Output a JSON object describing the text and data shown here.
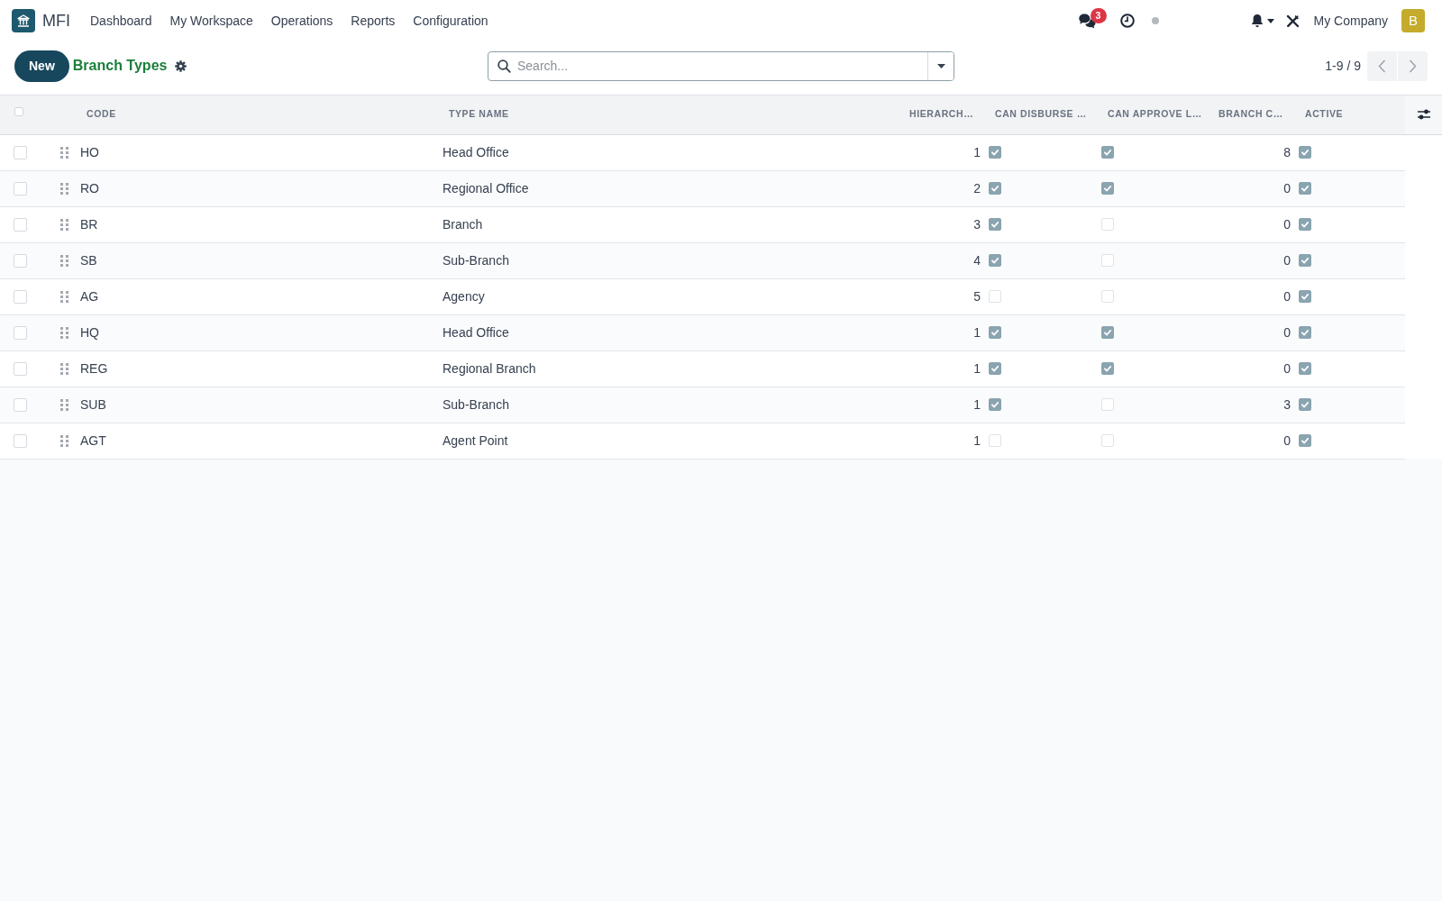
{
  "navbar": {
    "app_name": "MFI",
    "menu": [
      "Dashboard",
      "My Workspace",
      "Operations",
      "Reports",
      "Configuration"
    ],
    "unread_messages": "3",
    "company": "My Company",
    "avatar_initial": "B"
  },
  "control_panel": {
    "new_button": "New",
    "title": "Branch Types",
    "search": {
      "placeholder": "Search..."
    },
    "pager": "1-9 / 9"
  },
  "table": {
    "select_all": {
      "checked": false
    },
    "columns": [
      {
        "label": "CODE",
        "kind": "text"
      },
      {
        "label": "TYPE NAME",
        "kind": "text"
      },
      {
        "label": "HIERARCH…",
        "kind": "number"
      },
      {
        "label": "CAN DISBURSE …",
        "kind": "boolean"
      },
      {
        "label": "CAN APPROVE L…",
        "kind": "boolean"
      },
      {
        "label": "BRANCH C…",
        "kind": "number"
      },
      {
        "label": "ACTIVE",
        "kind": "boolean"
      }
    ],
    "rows": [
      {
        "selected": false,
        "cells": [
          {
            "text": "HO"
          },
          {
            "text": "Head Office"
          },
          {
            "text": "1"
          },
          {
            "checked": true
          },
          {
            "checked": true
          },
          {
            "text": "8"
          },
          {
            "checked": true
          }
        ]
      },
      {
        "selected": false,
        "cells": [
          {
            "text": "RO"
          },
          {
            "text": "Regional Office"
          },
          {
            "text": "2"
          },
          {
            "checked": true
          },
          {
            "checked": true
          },
          {
            "text": "0"
          },
          {
            "checked": true
          }
        ]
      },
      {
        "selected": false,
        "cells": [
          {
            "text": "BR"
          },
          {
            "text": "Branch"
          },
          {
            "text": "3"
          },
          {
            "checked": true
          },
          {
            "checked": false
          },
          {
            "text": "0"
          },
          {
            "checked": true
          }
        ]
      },
      {
        "selected": false,
        "cells": [
          {
            "text": "SB"
          },
          {
            "text": "Sub-Branch"
          },
          {
            "text": "4"
          },
          {
            "checked": true
          },
          {
            "checked": false
          },
          {
            "text": "0"
          },
          {
            "checked": true
          }
        ]
      },
      {
        "selected": false,
        "cells": [
          {
            "text": "AG"
          },
          {
            "text": "Agency"
          },
          {
            "text": "5"
          },
          {
            "checked": false
          },
          {
            "checked": false
          },
          {
            "text": "0"
          },
          {
            "checked": true
          }
        ]
      },
      {
        "selected": false,
        "cells": [
          {
            "text": "HQ"
          },
          {
            "text": "Head Office"
          },
          {
            "text": "1"
          },
          {
            "checked": true
          },
          {
            "checked": true
          },
          {
            "text": "0"
          },
          {
            "checked": true
          }
        ]
      },
      {
        "selected": false,
        "cells": [
          {
            "text": "REG"
          },
          {
            "text": "Regional Branch"
          },
          {
            "text": "1"
          },
          {
            "checked": true
          },
          {
            "checked": true
          },
          {
            "text": "0"
          },
          {
            "checked": true
          }
        ]
      },
      {
        "selected": false,
        "cells": [
          {
            "text": "SUB"
          },
          {
            "text": "Sub-Branch"
          },
          {
            "text": "1"
          },
          {
            "checked": true
          },
          {
            "checked": false
          },
          {
            "text": "3"
          },
          {
            "checked": true
          }
        ]
      },
      {
        "selected": false,
        "cells": [
          {
            "text": "AGT"
          },
          {
            "text": "Agent Point"
          },
          {
            "text": "1"
          },
          {
            "checked": false
          },
          {
            "checked": false
          },
          {
            "text": "0"
          },
          {
            "checked": true
          }
        ]
      }
    ]
  }
}
